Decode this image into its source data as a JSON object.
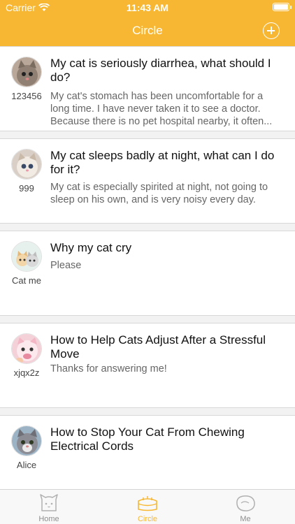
{
  "status_bar": {
    "carrier": "Carrier",
    "time": "11:43 AM"
  },
  "nav": {
    "title": "Circle"
  },
  "posts": [
    {
      "username": "123456",
      "title": "My cat is seriously diarrhea, what should I do?",
      "body": "My cat's stomach has been uncomfortable for a long time. I have never taken it to see a doctor. Because there is no pet hospital nearby, it often..."
    },
    {
      "username": "999",
      "title": "My cat sleeps badly at night, what can I do for it?",
      "body": "My cat is especially spirited at night, not going to sleep on his own, and is very noisy every day."
    },
    {
      "username": "Cat me",
      "title": "Why my cat cry",
      "body": "Please"
    },
    {
      "username": "xjqx2z",
      "title": "How to Help Cats Adjust After a Stressful Move",
      "body": "Thanks for answering me!"
    },
    {
      "username": "Alice",
      "title": "How to Stop Your Cat From Chewing Electrical Cords",
      "body": ""
    }
  ],
  "tabs": [
    {
      "label": "Home",
      "icon": "cat-face-icon"
    },
    {
      "label": "Circle",
      "icon": "cat-bed-icon"
    },
    {
      "label": "Me",
      "icon": "bean-icon"
    }
  ],
  "colors": {
    "accent": "#f7b733",
    "tab_inactive": "#8e8e8e"
  }
}
